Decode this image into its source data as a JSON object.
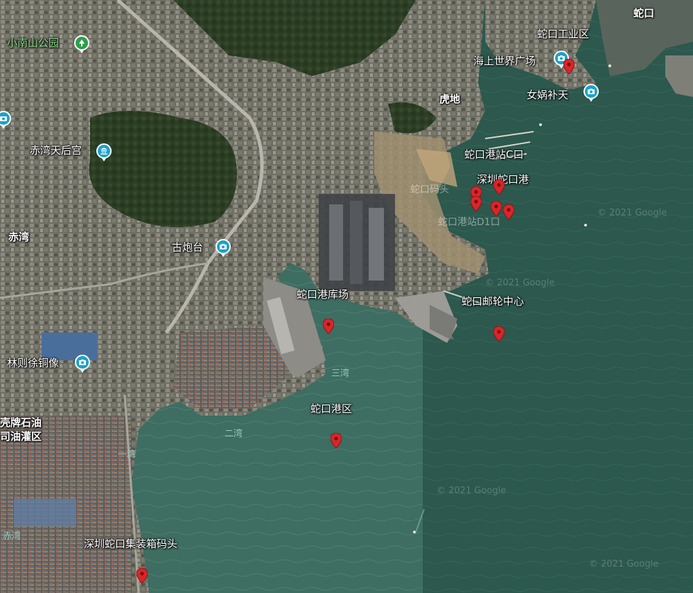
{
  "labels": {
    "shekou": "蛇口",
    "shekou_industrial": "蛇口工业区",
    "sea_world": "海上世界广场",
    "nuwa": "女娲补天",
    "hudi": "虎地",
    "xiaonanshan": "小南山公园",
    "chiwan_tianhou": "赤湾天后宫",
    "chiwan_bold": "赤湾",
    "gupaotai": "古炮台",
    "port_c": "蛇口港站C口",
    "shenzhen_shekou_port": "深圳蛇口港",
    "pier_faded": "蛇口码头",
    "port_d1": "蛇口港站D1口",
    "watermark_1": "© 2021 Google",
    "watermark_2": "© 2021 Google",
    "watermark_3": "© 2021 Google",
    "watermark_4": "© 2021 Google",
    "port_warehouse": "蛇口港库场",
    "cruise_center": "蛇口邮轮中心",
    "linzexu": "林则徐铜像",
    "sanwan": "三湾",
    "shell_oil_1": "壳牌石油",
    "shell_oil_2": "司油灌区",
    "shekou_port_area": "蛇口港区",
    "erwan": "二湾",
    "yiwan": "一湾",
    "chiwan_small": "赤湾",
    "container_terminal": "深圳蛇口集装箱码头"
  },
  "icons": {
    "camera": "camera-icon",
    "park": "tree-icon",
    "temple": "temple-icon",
    "pin": "map-pin-icon"
  },
  "colors": {
    "water": "#2f5a4e",
    "land": "#6b6a5c",
    "pin": "#d8262a",
    "poi_blue": "#1ba3c9",
    "poi_green": "#2e9e4a"
  }
}
